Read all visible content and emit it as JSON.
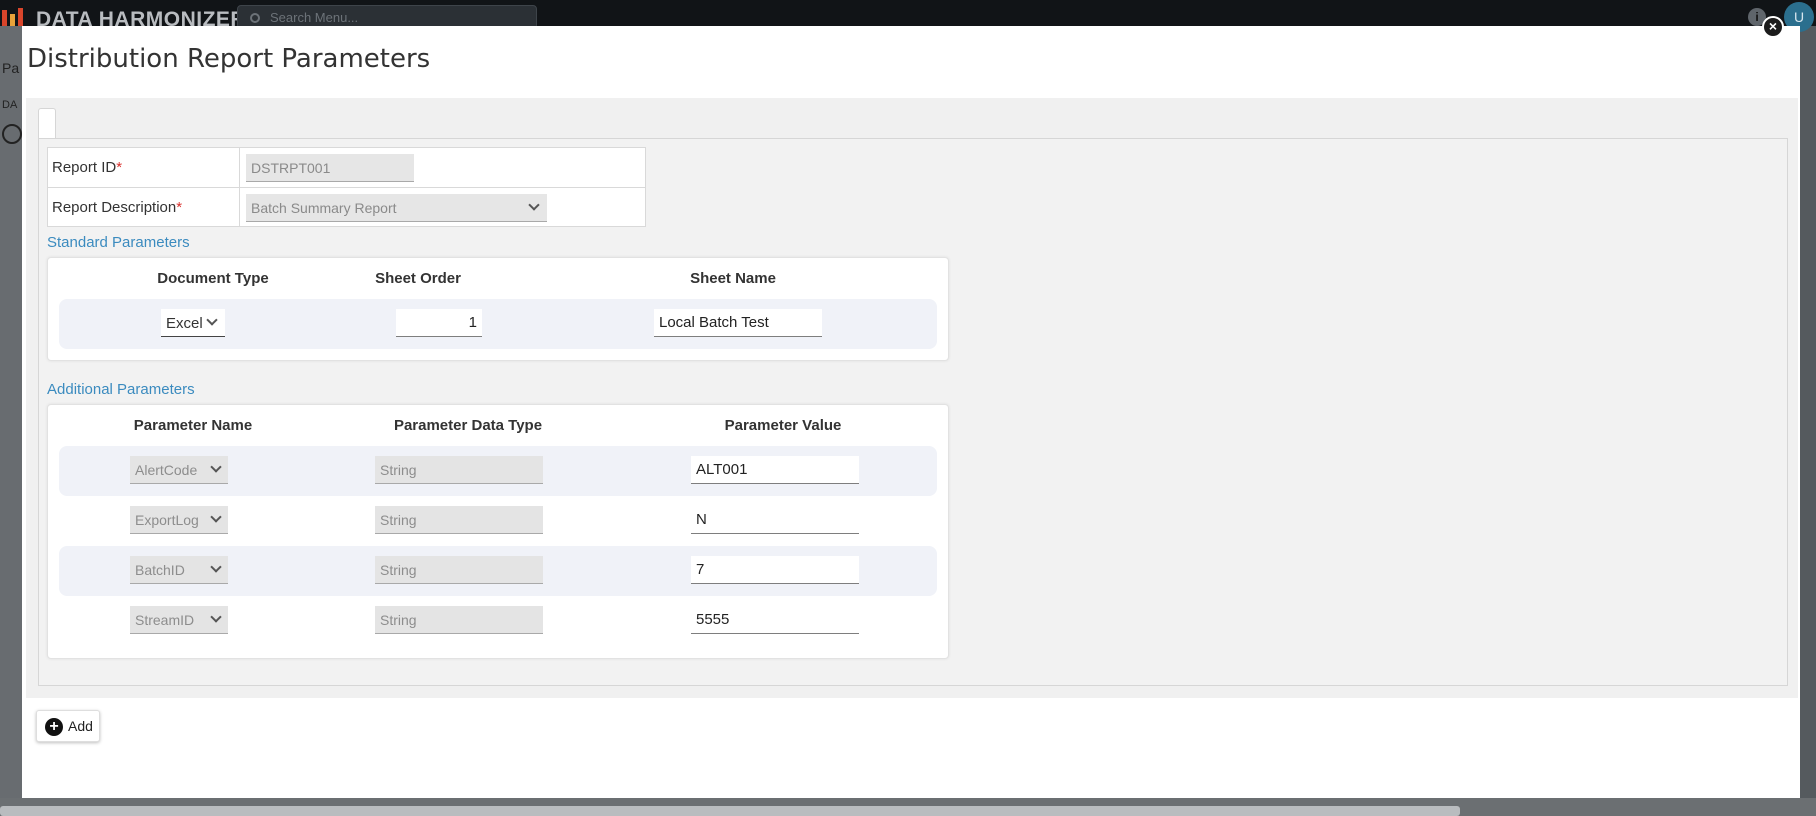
{
  "background": {
    "brand": "DATA HARMONIZER",
    "search_placeholder": "Search Menu...",
    "info_icon": "info-icon",
    "avatar_initial": "U",
    "left_text_1": "Pa",
    "left_text_2": "DA"
  },
  "modal": {
    "title": "Distribution Report Parameters",
    "close_icon": "close-icon",
    "report_id": {
      "label": "Report ID",
      "value": "DSTRPT001"
    },
    "report_description": {
      "label": "Report Description",
      "value": "Batch Summary Report"
    },
    "required_marker": "*",
    "standard": {
      "section_label": "Standard Parameters",
      "headers": [
        "Document Type",
        "Sheet Order",
        "Sheet Name"
      ],
      "row": {
        "document_type": "Excel",
        "sheet_order": "1",
        "sheet_name": "Local Batch Test"
      }
    },
    "additional": {
      "section_label": "Additional Parameters",
      "headers": [
        "Parameter Name",
        "Parameter Data Type",
        "Parameter Value"
      ],
      "rows": [
        {
          "name": "AlertCode",
          "type": "String",
          "value": "ALT001"
        },
        {
          "name": "ExportLog",
          "type": "String",
          "value": "N"
        },
        {
          "name": "BatchID",
          "type": "String",
          "value": "7"
        },
        {
          "name": "StreamID",
          "type": "String",
          "value": "5555"
        }
      ]
    },
    "add_button": {
      "label": "Add",
      "icon": "plus-circle-icon"
    }
  },
  "colors": {
    "accent": "#3b8bbf",
    "required": "#d9302c",
    "row_shade": "#f0f2f8"
  }
}
